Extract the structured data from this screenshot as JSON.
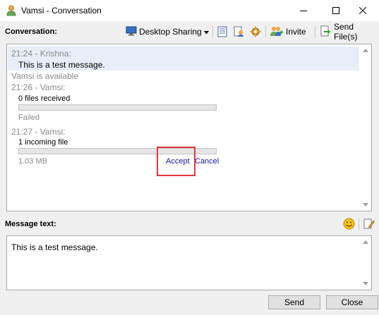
{
  "window": {
    "title": "Vamsi - Conversation"
  },
  "toolbar": {
    "conversation_label": "Conversation:",
    "desktop_sharing_label": "Desktop Sharing",
    "invite_label": "Invite",
    "send_files_label": "Send File(s)"
  },
  "conversation": {
    "entries": [
      {
        "header": "21:24 - Krishna:",
        "body": "This is a test message."
      },
      {
        "status": "Vamsi is available"
      },
      {
        "header": "21:26 - Vamsi:",
        "body": "0 files received",
        "transfer_status": "Failed",
        "progress": 0
      },
      {
        "header": "21:27 - Vamsi:",
        "body": "1 incoming file",
        "size": "1.03 MB",
        "progress": 0,
        "accept_label": "Accept",
        "cancel_label": "Cancel"
      }
    ]
  },
  "compose": {
    "label": "Message text:",
    "value": "This is a test message."
  },
  "buttons": {
    "send": "Send",
    "close": "Close"
  },
  "colors": {
    "highlight": "#e8eef7",
    "link": "#1a1a9c",
    "annotation": "#e0383e"
  },
  "icons": [
    "user-icon",
    "minimize-icon",
    "maximize-icon",
    "close-icon",
    "desktop-sharing-icon",
    "dropdown-arrow-icon",
    "history-icon",
    "contact-info-icon",
    "settings-icon",
    "invite-icon",
    "send-file-icon",
    "smiley-icon",
    "edit-icon",
    "scroll-up-icon",
    "scroll-down-icon"
  ]
}
